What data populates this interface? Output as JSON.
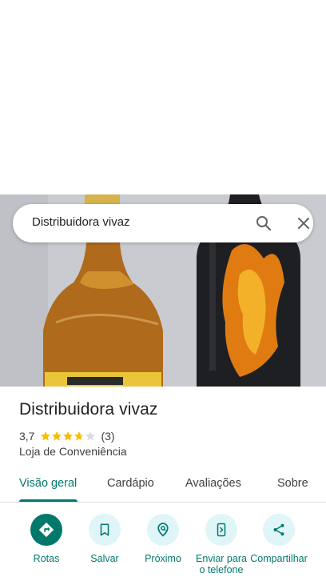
{
  "search": {
    "query": "Distribuidora vivaz"
  },
  "icons": {
    "search": "search-icon",
    "close": "close-icon",
    "star": "star-icon"
  },
  "place": {
    "name": "Distribuidora vivaz",
    "rating": "3,7",
    "rating_value": 3.7,
    "review_count": "(3)",
    "category": "Loja de Conveniência"
  },
  "tabs": [
    {
      "label": "Visão geral",
      "active": true
    },
    {
      "label": "Cardápio",
      "active": false
    },
    {
      "label": "Avaliações",
      "active": false
    },
    {
      "label": "Sobre",
      "active": false
    }
  ],
  "actions": [
    {
      "label": "Rotas",
      "icon": "directions-icon"
    },
    {
      "label": "Salvar",
      "icon": "bookmark-icon"
    },
    {
      "label": "Próximo",
      "icon": "nearby-icon"
    },
    {
      "label": "Enviar para o telefone",
      "icon": "send-to-phone-icon"
    },
    {
      "label": "Compartilhar",
      "icon": "share-icon"
    }
  ],
  "colors": {
    "accent": "#00796b",
    "action_bg": "#e0f5f8",
    "star": "#fbbc04",
    "star_empty": "#dadce0"
  }
}
